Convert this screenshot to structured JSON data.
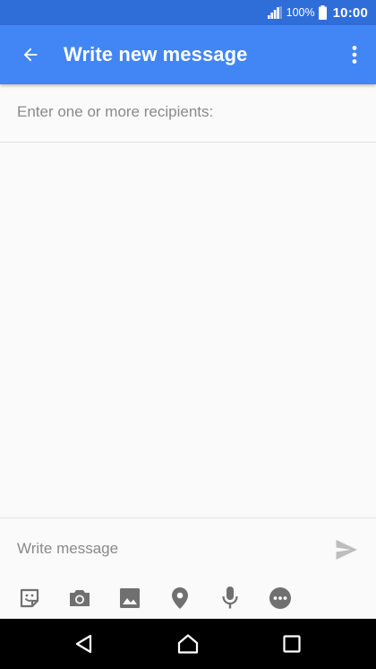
{
  "status_bar": {
    "battery_percent": "100%",
    "time": "10:00",
    "icons": [
      "signal-icon",
      "battery-icon"
    ]
  },
  "app_bar": {
    "title": "Write new message",
    "back_icon": "arrow-back-icon",
    "menu_icon": "more-vert-icon",
    "color": "#4285f4"
  },
  "recipients": {
    "placeholder": "Enter one or more recipients:",
    "value": ""
  },
  "compose": {
    "placeholder": "Write message",
    "value": "",
    "send_icon": "send-icon",
    "attachments": [
      "sticker-icon",
      "camera-icon",
      "image-icon",
      "location-icon",
      "microphone-icon",
      "more-options-icon"
    ]
  },
  "nav_bar": {
    "buttons": [
      "back-triangle-icon",
      "home-icon",
      "recents-icon"
    ]
  },
  "colors": {
    "status_bar": "#2f6dd9",
    "app_bar": "#4285f4",
    "background": "#fafafa",
    "icon_grey": "#707070",
    "send_grey": "#bdbdbd"
  }
}
